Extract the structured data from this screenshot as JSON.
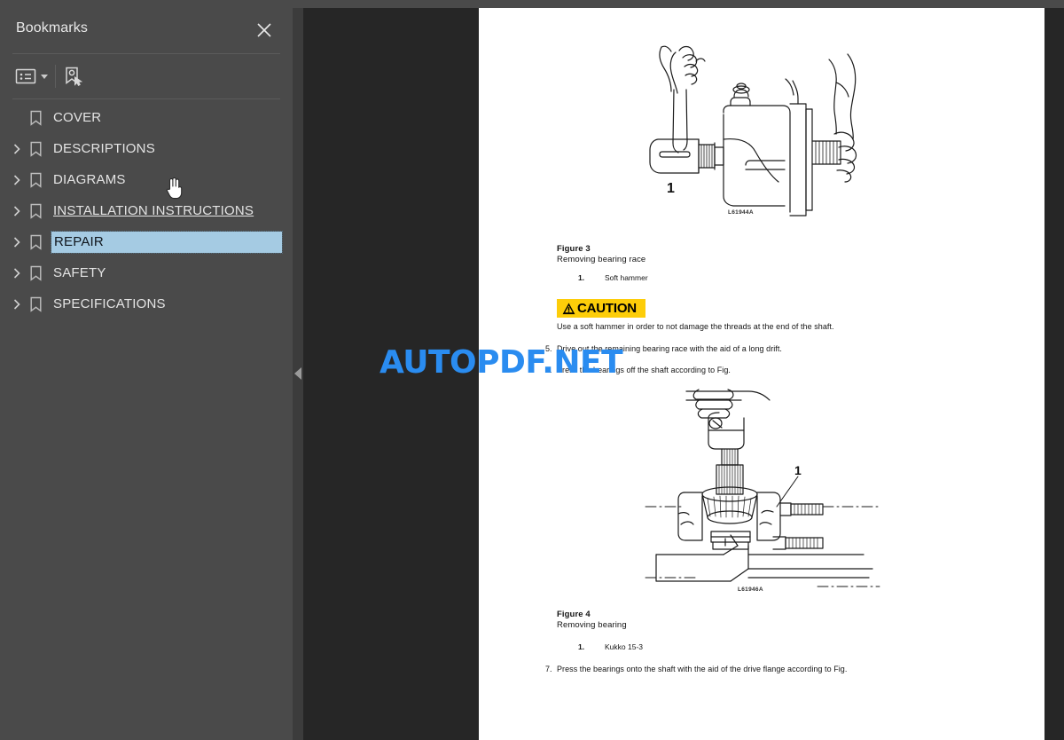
{
  "sidebar": {
    "title": "Bookmarks",
    "close_icon": "close-icon",
    "toolbar": {
      "options_label": "list-options-icon",
      "new_bookmark_label": "new-bookmark-icon"
    },
    "items": [
      {
        "label": "COVER",
        "expandable": false,
        "state": "normal"
      },
      {
        "label": "DESCRIPTIONS",
        "expandable": true,
        "state": "normal"
      },
      {
        "label": "DIAGRAMS",
        "expandable": true,
        "state": "normal"
      },
      {
        "label": "INSTALLATION INSTRUCTIONS",
        "expandable": true,
        "state": "hovered"
      },
      {
        "label": "REPAIR",
        "expandable": true,
        "state": "selected"
      },
      {
        "label": "SAFETY",
        "expandable": true,
        "state": "normal"
      },
      {
        "label": "SPECIFICATIONS",
        "expandable": true,
        "state": "normal"
      }
    ]
  },
  "panel": {
    "collapse_handle_icon": "collapse-left-arrow-icon"
  },
  "watermark": {
    "text": "AUTOPDF.NET",
    "color": "#2a8cf0"
  },
  "document": {
    "figure3": {
      "title": "Figure 3",
      "subtitle": "Removing bearing race",
      "code": "L61944A",
      "callouts": [
        {
          "num": "1.",
          "text": "Soft hammer"
        }
      ],
      "callout_marker": "1"
    },
    "caution": {
      "word": "CAUTION",
      "icon": "warning-triangle-icon",
      "background": "#fdcd09",
      "description": "Use a soft hammer in order to not damage the threads at the end of the shaft."
    },
    "steps_upper": [
      {
        "num": "5.",
        "text": "Drive out the remaining bearing race with the aid of a long drift."
      },
      {
        "num": "6.",
        "text": "Press the bearings off the shaft according to Fig."
      }
    ],
    "figure4": {
      "title": "Figure 4",
      "subtitle": "Removing bearing",
      "code": "L61946A",
      "callouts": [
        {
          "num": "1.",
          "text": "Kukko 15-3"
        }
      ],
      "callout_marker": "1"
    },
    "steps_lower": [
      {
        "num": "7.",
        "text": "Press the bearings onto the shaft with the aid of the drive flange according to Fig."
      }
    ]
  }
}
